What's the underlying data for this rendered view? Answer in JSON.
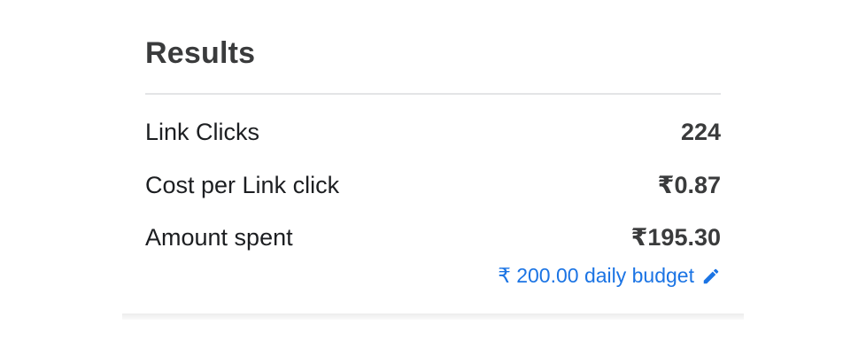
{
  "results": {
    "title": "Results",
    "rows": [
      {
        "label": "Link Clicks",
        "value": "224"
      },
      {
        "label": "Cost per Link click",
        "value": "₹0.87"
      },
      {
        "label": "Amount spent",
        "value": "₹195.30"
      }
    ],
    "budget_link": "₹ 200.00 daily budget"
  },
  "colors": {
    "link": "#1b74e4",
    "text": "#1c1e21",
    "value": "#3a3b3c",
    "divider": "#e3e4e6"
  },
  "icons": {
    "edit": "pencil-icon"
  }
}
